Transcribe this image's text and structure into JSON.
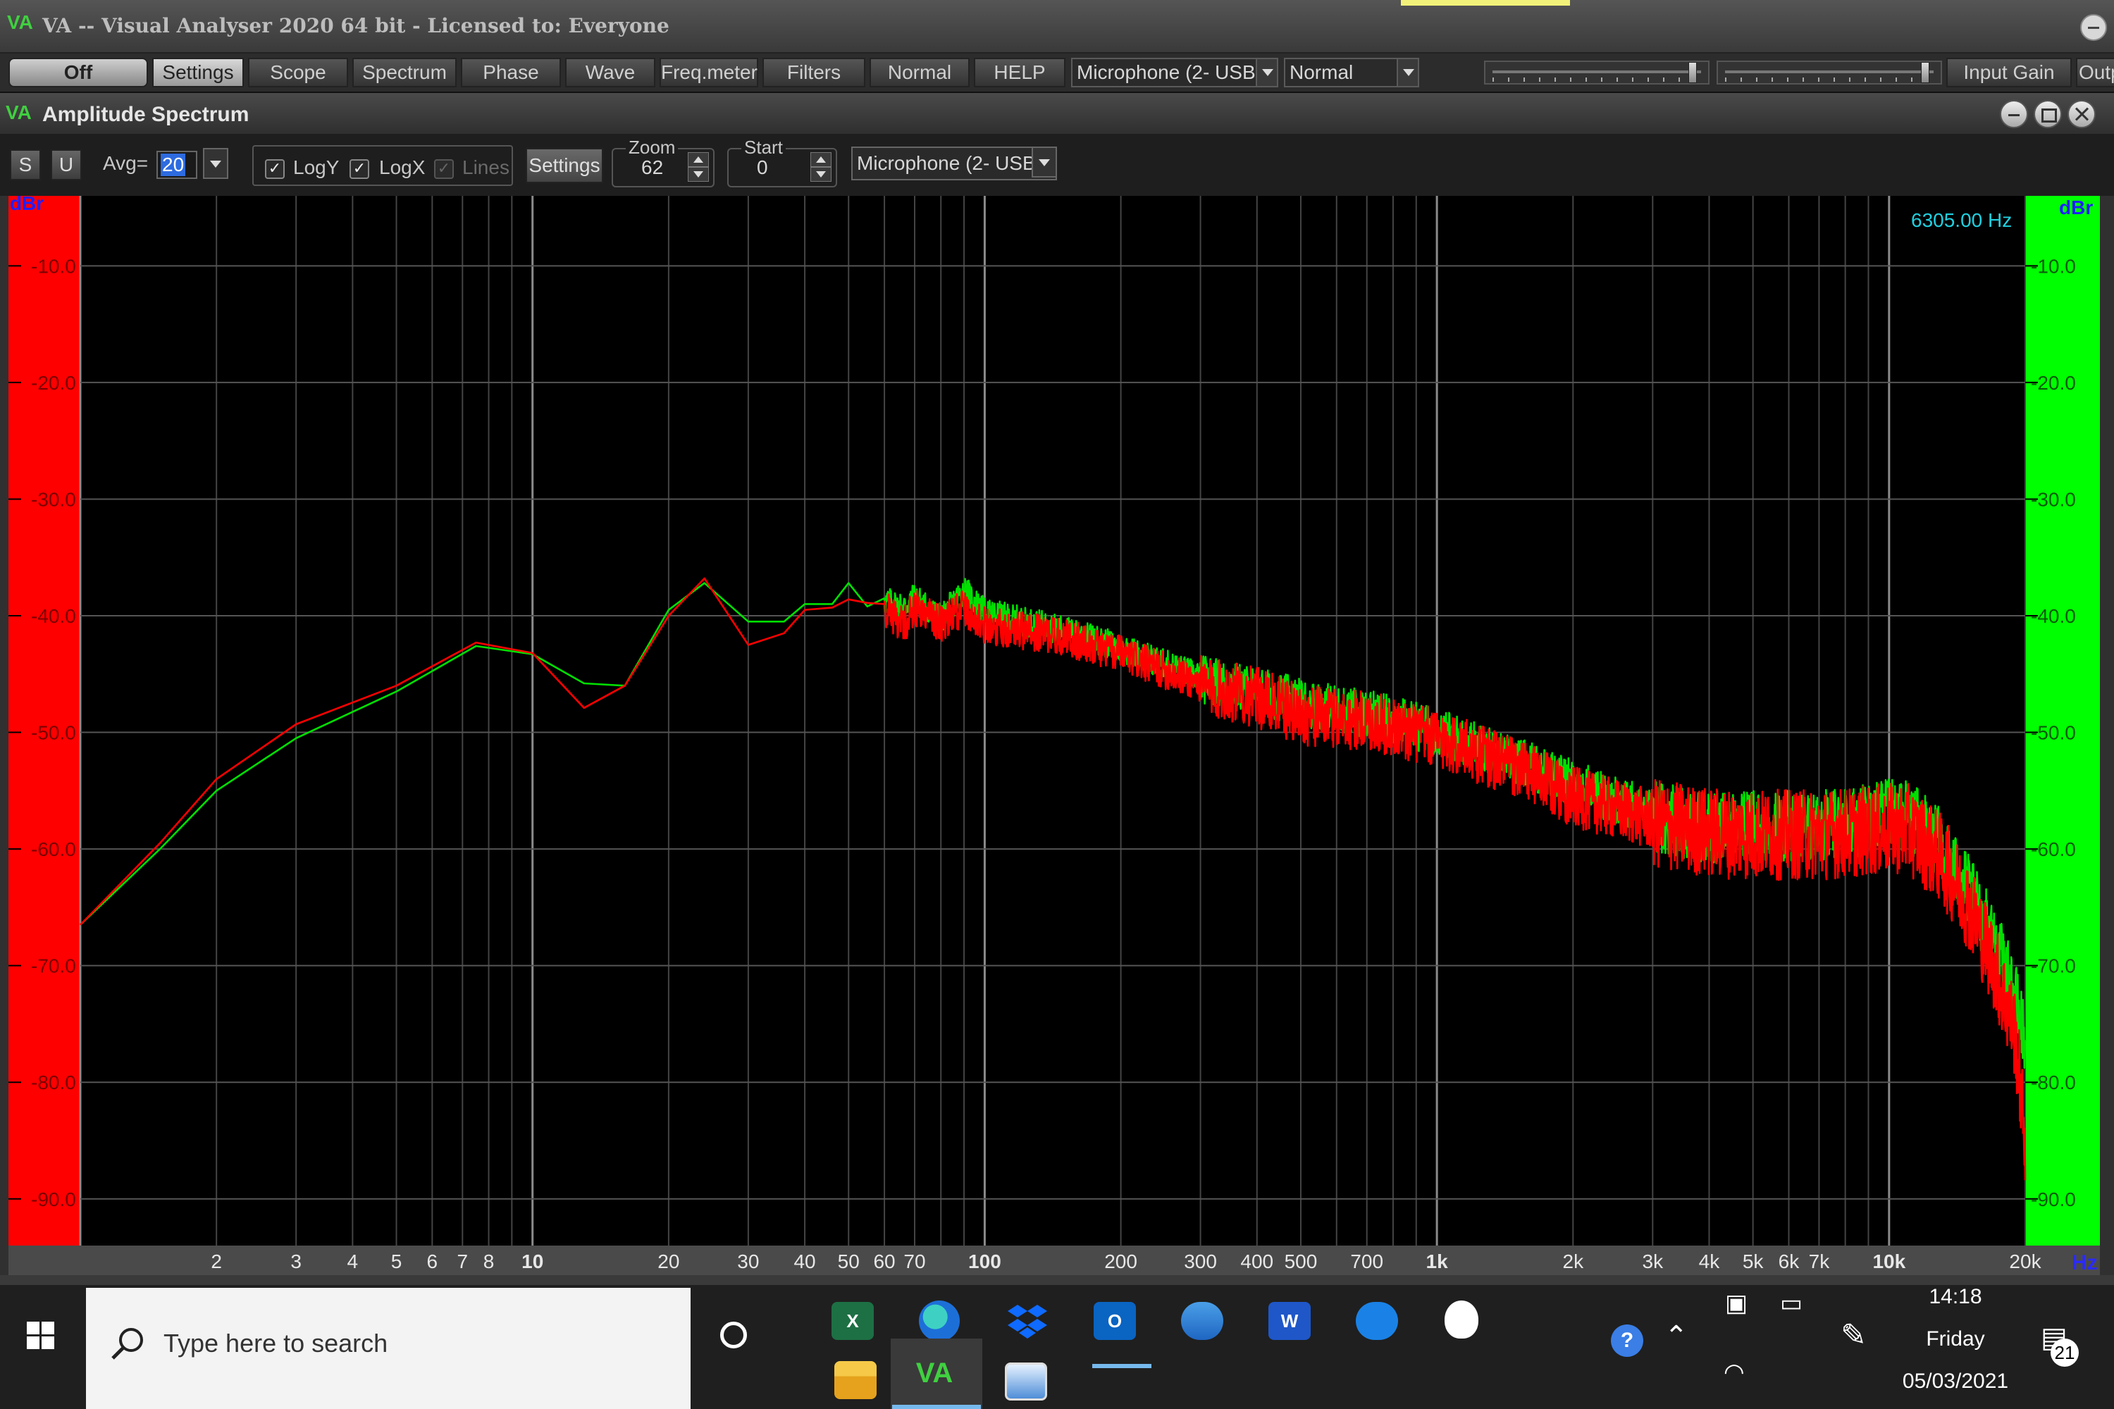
{
  "app": {
    "title": "VA -- Visual Analyser 2020 64 bit - Licensed to: Everyone",
    "logo_text": "VA"
  },
  "toolbar": {
    "off_label": "Off",
    "buttons": [
      "Settings",
      "Scope",
      "Spectrum",
      "Phase",
      "Wave",
      "Freq.meter",
      "Filters",
      "Normal",
      "HELP"
    ],
    "input_device": "Microphone (2- USB",
    "mode": "Normal",
    "input_gain_label": "Input Gain",
    "output_label": "Outp",
    "slider1_level": 0.96,
    "slider2_level": 0.96
  },
  "window": {
    "title": "Amplitude Spectrum",
    "logo_text": "VA"
  },
  "spec": {
    "s_label": "S",
    "u_label": "U",
    "avg_label": "Avg=",
    "avg_value": "20",
    "logy_label": "LogY",
    "logx_label": "LogX",
    "lines_label": "Lines",
    "logy_checked": true,
    "logx_checked": true,
    "lines_checked": true,
    "settings_label": "Settings",
    "zoom_label": "Zoom",
    "zoom_value": "62",
    "start_label": "Start",
    "start_value": "0",
    "channel_device": "Microphone (2- USB"
  },
  "chart_data": {
    "type": "line",
    "cursor_readout": "6305.00 Hz",
    "y_unit_left": "dBr",
    "y_unit_right": "dBr",
    "x_unit": "Hz",
    "x_scale": "log",
    "xlim": [
      1,
      20000
    ],
    "ylim": [
      -94,
      -4
    ],
    "y_ticks": [
      "-10.0",
      "-20.0",
      "-30.0",
      "-40.0",
      "-50.0",
      "-60.0",
      "-70.0",
      "-80.0",
      "-90.0"
    ],
    "x_ticks": [
      {
        "v": 2,
        "label": "2"
      },
      {
        "v": 3,
        "label": "3"
      },
      {
        "v": 4,
        "label": "4"
      },
      {
        "v": 5,
        "label": "5"
      },
      {
        "v": 6,
        "label": "6"
      },
      {
        "v": 7,
        "label": "7"
      },
      {
        "v": 8,
        "label": "8"
      },
      {
        "v": 10,
        "label": "10",
        "major": true
      },
      {
        "v": 20,
        "label": "20"
      },
      {
        "v": 30,
        "label": "30"
      },
      {
        "v": 40,
        "label": "40"
      },
      {
        "v": 50,
        "label": "50"
      },
      {
        "v": 60,
        "label": "60"
      },
      {
        "v": 70,
        "label": "70"
      },
      {
        "v": 100,
        "label": "100",
        "major": true
      },
      {
        "v": 200,
        "label": "200"
      },
      {
        "v": 300,
        "label": "300"
      },
      {
        "v": 400,
        "label": "400"
      },
      {
        "v": 500,
        "label": "500"
      },
      {
        "v": 700,
        "label": "700"
      },
      {
        "v": 1000,
        "label": "1k",
        "major": true
      },
      {
        "v": 2000,
        "label": "2k"
      },
      {
        "v": 3000,
        "label": "3k"
      },
      {
        "v": 4000,
        "label": "4k"
      },
      {
        "v": 5000,
        "label": "5k"
      },
      {
        "v": 6000,
        "label": "6k"
      },
      {
        "v": 7000,
        "label": "7k"
      },
      {
        "v": 10000,
        "label": "10k",
        "major": true
      },
      {
        "v": 20000,
        "label": "20k"
      }
    ],
    "series": [
      {
        "color": "#00e000",
        "points": [
          [
            1,
            -66.5
          ],
          [
            1.5,
            -60
          ],
          [
            2,
            -55
          ],
          [
            3,
            -50.5
          ],
          [
            5,
            -46.5
          ],
          [
            7.5,
            -42.6
          ],
          [
            10,
            -43.3
          ],
          [
            13,
            -45.8
          ],
          [
            16,
            -46
          ],
          [
            20,
            -39.5
          ],
          [
            24,
            -37.2
          ],
          [
            30,
            -40.5
          ],
          [
            36,
            -40.5
          ],
          [
            40,
            -39
          ],
          [
            46,
            -39
          ],
          [
            50,
            -37.2
          ],
          [
            55,
            -39.2
          ],
          [
            60,
            -38.5
          ],
          [
            66,
            -39
          ],
          [
            70,
            -38.2
          ],
          [
            80,
            -40
          ],
          [
            90,
            -37.5
          ],
          [
            100,
            -39.5
          ],
          [
            150,
            -41
          ],
          [
            200,
            -42.5
          ],
          [
            300,
            -45
          ],
          [
            400,
            -46
          ],
          [
            500,
            -47
          ],
          [
            700,
            -48
          ],
          [
            1000,
            -49.5
          ],
          [
            1500,
            -52
          ],
          [
            2000,
            -54
          ],
          [
            3000,
            -56.5
          ],
          [
            4000,
            -57.5
          ],
          [
            5000,
            -57.5
          ],
          [
            7000,
            -57.5
          ],
          [
            10000,
            -56.5
          ],
          [
            11000,
            -56.5
          ],
          [
            13000,
            -59
          ],
          [
            15000,
            -63
          ],
          [
            17000,
            -67
          ],
          [
            19000,
            -72
          ],
          [
            20000,
            -76
          ]
        ],
        "noise_from": 60,
        "noise_amp": 1.6
      },
      {
        "color": "#ff0000",
        "points": [
          [
            1,
            -66.5
          ],
          [
            1.5,
            -59.5
          ],
          [
            2,
            -54
          ],
          [
            3,
            -49.3
          ],
          [
            5,
            -46
          ],
          [
            7.5,
            -42.3
          ],
          [
            10,
            -43.2
          ],
          [
            13,
            -47.9
          ],
          [
            16,
            -46
          ],
          [
            20,
            -40
          ],
          [
            24,
            -36.8
          ],
          [
            30,
            -42.5
          ],
          [
            36,
            -41.5
          ],
          [
            40,
            -39.5
          ],
          [
            46,
            -39.3
          ],
          [
            50,
            -38.6
          ],
          [
            55,
            -38.9
          ],
          [
            60,
            -39
          ],
          [
            66,
            -40.5
          ],
          [
            70,
            -39
          ],
          [
            80,
            -40.3
          ],
          [
            90,
            -39
          ],
          [
            100,
            -40.5
          ],
          [
            150,
            -41.5
          ],
          [
            200,
            -43
          ],
          [
            300,
            -45.5
          ],
          [
            400,
            -46.5
          ],
          [
            500,
            -48
          ],
          [
            700,
            -48.5
          ],
          [
            1000,
            -50
          ],
          [
            1500,
            -52.5
          ],
          [
            2000,
            -55
          ],
          [
            3000,
            -57
          ],
          [
            4000,
            -57.8
          ],
          [
            5000,
            -58
          ],
          [
            7000,
            -58
          ],
          [
            10000,
            -57.5
          ],
          [
            11000,
            -57.5
          ],
          [
            13000,
            -60
          ],
          [
            15000,
            -64
          ],
          [
            17000,
            -69
          ],
          [
            19000,
            -75
          ],
          [
            20000,
            -84
          ]
        ],
        "noise_from": 60,
        "noise_amp": 2.0
      }
    ]
  },
  "taskbar": {
    "search_placeholder": "Type here to search",
    "time": "14:18",
    "day": "Friday",
    "date": "05/03/2021",
    "notification_count": "21",
    "excel_letter": "X",
    "word_letter": "W",
    "va_letter": "VA",
    "outlook_letter": "O"
  }
}
